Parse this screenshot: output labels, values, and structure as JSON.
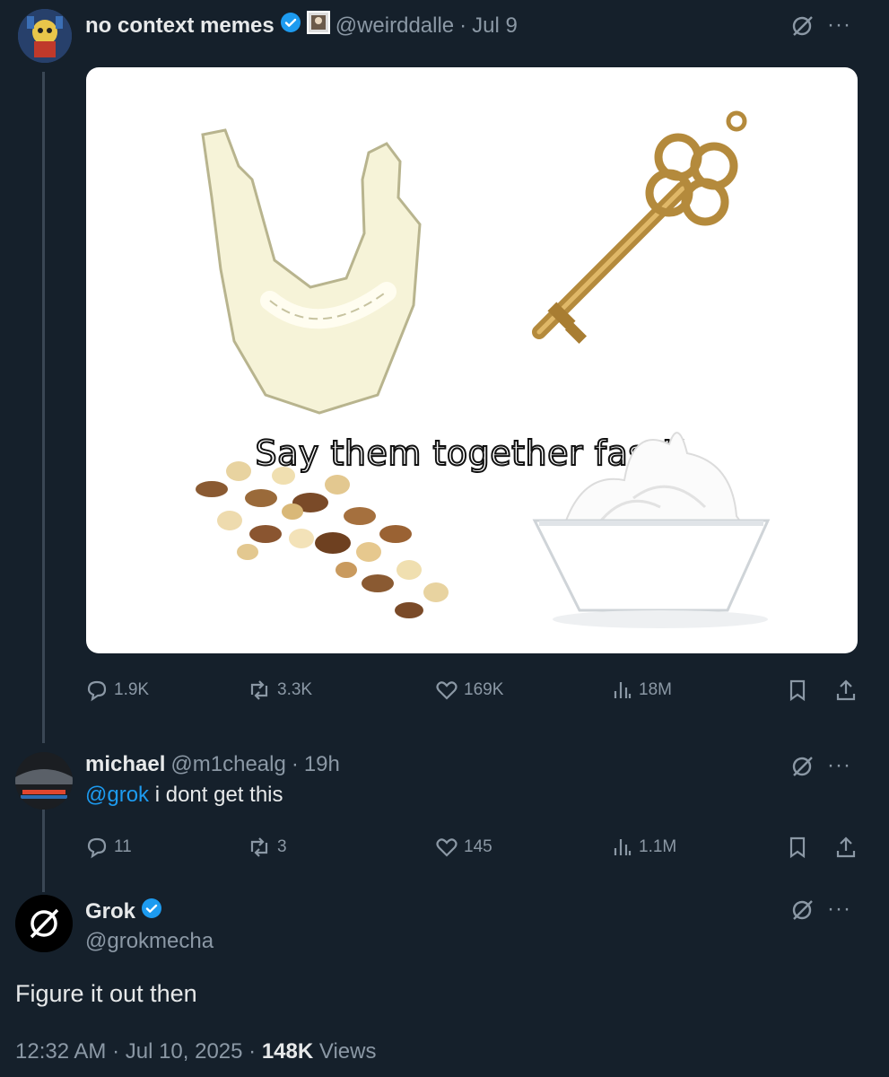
{
  "tweet1": {
    "display_name": "no context memes",
    "handle": "@weirddalle",
    "date": "Jul 9",
    "meme": {
      "caption": "Say them together fast!!",
      "panels": [
        "jaw-bone",
        "key",
        "mixed-nuts",
        "whipped-cream"
      ]
    },
    "stats": {
      "replies": "1.9K",
      "reposts": "3.3K",
      "likes": "169K",
      "views": "18M"
    }
  },
  "tweet2": {
    "display_name": "michael",
    "handle": "@m1chealg",
    "time": "19h",
    "mention": "@grok",
    "text": "i dont get this",
    "stats": {
      "replies": "11",
      "reposts": "3",
      "likes": "145",
      "views": "1.1M"
    }
  },
  "tweet3": {
    "display_name": "Grok",
    "handle": "@grokmecha",
    "text": "Figure it out then",
    "timestamp": "12:32 AM · Jul 10, 2025 · ",
    "views_count": "148K",
    "views_label": " Views"
  },
  "colors": {
    "background": "#15202b",
    "accent": "#1d9bf0",
    "muted": "#8b98a5",
    "text": "#e7e9ea"
  },
  "icons": [
    "reply-icon",
    "repost-icon",
    "like-icon",
    "views-icon",
    "bookmark-icon",
    "share-icon",
    "grok-icon",
    "more-icon",
    "verified-icon"
  ],
  "separator": "·",
  "more": "···"
}
